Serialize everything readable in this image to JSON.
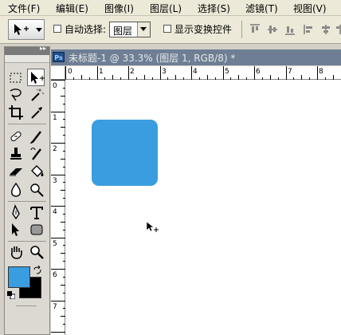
{
  "menu": {
    "items": [
      "文件(F)",
      "编辑(E)",
      "图像(I)",
      "图层(L)",
      "选择(S)",
      "滤镜(T)",
      "视图(V)"
    ]
  },
  "options": {
    "auto_select_label": "自动选择:",
    "auto_select_value": "图层",
    "show_transform_label": "显示变换控件",
    "auto_select_checked": false,
    "show_transform_checked": false
  },
  "document": {
    "badge": "Ps",
    "title": "未标题-1 @ 33.3% (图层 1, RGB/8) *"
  },
  "ruler": {
    "h_labels": [
      "0",
      "1",
      "2",
      "3",
      "4",
      "5",
      "6",
      "7",
      "8"
    ],
    "v_labels": [
      "0",
      "1",
      "2",
      "3",
      "4",
      "5",
      "6",
      "7",
      "8"
    ]
  },
  "colors": {
    "foreground": "#3a9de0",
    "background": "#000000",
    "shape": "#3a9de0"
  },
  "tools": [
    "rectangular-marquee-icon",
    "move-icon",
    "lasso-icon",
    "magic-wand-icon",
    "crop-icon",
    "eyedropper-icon",
    "healing-brush-icon",
    "brush-icon",
    "clone-stamp-icon",
    "history-brush-icon",
    "eraser-icon",
    "paint-bucket-icon",
    "blur-icon",
    "dodge-icon",
    "pen-icon",
    "type-icon",
    "path-selection-icon",
    "rounded-rectangle-icon",
    "hand-icon",
    "zoom-icon"
  ]
}
